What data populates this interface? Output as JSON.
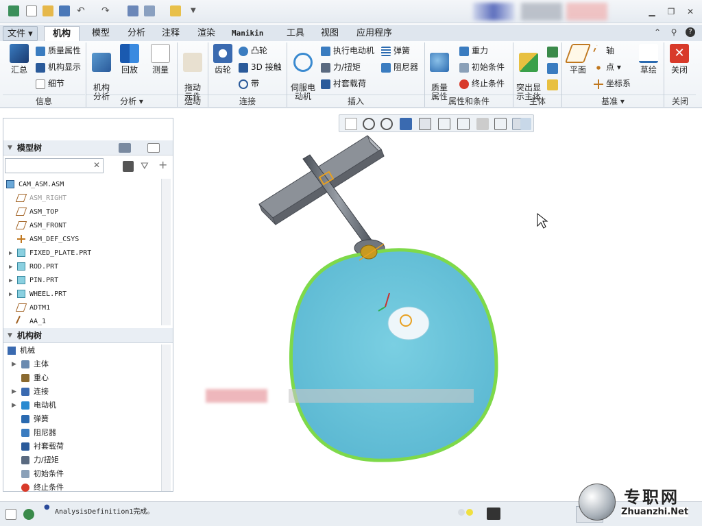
{
  "tabs": [
    {
      "label": "文件",
      "dropdown": true
    },
    {
      "label": "机构",
      "active": true
    },
    {
      "label": "模型"
    },
    {
      "label": "分析"
    },
    {
      "label": "注释"
    },
    {
      "label": "渲染"
    },
    {
      "label": "Manikin"
    },
    {
      "label": "工具"
    },
    {
      "label": "视图"
    },
    {
      "label": "应用程序"
    }
  ],
  "ribbon": {
    "info": {
      "group": "信息",
      "summary": "汇总",
      "mass_props": "质量属性",
      "mech_display": "机构显示",
      "detail": "细节"
    },
    "analysis": {
      "group": "分析",
      "mech_analysis": "机构\n分析",
      "playback": "回放",
      "measure": "测量"
    },
    "motion": {
      "group": "运动",
      "drag": "拖动\n元件"
    },
    "connection": {
      "group": "连接",
      "gear": "齿轮",
      "cam": "凸轮",
      "contact3d": "3D 接触",
      "belt": "带"
    },
    "insert": {
      "group": "插入",
      "servo": "伺服电\n动机",
      "exec_motor": "执行电动机",
      "force": "力/扭矩",
      "bushing": "衬套载荷",
      "spring": "弹簧",
      "damper": "阻尼器"
    },
    "props": {
      "group": "属性和条件",
      "mass": "质量\n属性",
      "gravity": "重力",
      "init_cond": "初始条件",
      "term_cond": "终止条件"
    },
    "body": {
      "group": "主体",
      "highlight": "突出显\n示主体"
    },
    "datum": {
      "group": "基准",
      "plane": "平面",
      "axis": "轴",
      "point": "点",
      "csys": "坐标系",
      "sketch": "草绘"
    },
    "close": {
      "group": "关闭",
      "close": "关闭"
    }
  },
  "model_tree": {
    "title": "模型树",
    "items": [
      {
        "label": "CAM_ASM.ASM",
        "icon": "assembly-icon"
      },
      {
        "label": "ASM_RIGHT",
        "icon": "datum-plane-icon",
        "dim": true
      },
      {
        "label": "ASM_TOP",
        "icon": "datum-plane-icon"
      },
      {
        "label": "ASM_FRONT",
        "icon": "datum-plane-icon"
      },
      {
        "label": "ASM_DEF_CSYS",
        "icon": "csys-icon"
      },
      {
        "label": "FIXED_PLATE.PRT",
        "icon": "part-icon",
        "expand": true
      },
      {
        "label": "ROD.PRT",
        "icon": "part-icon",
        "expand": true
      },
      {
        "label": "PIN.PRT",
        "icon": "part-icon",
        "expand": true
      },
      {
        "label": "WHEEL.PRT",
        "icon": "part-icon",
        "expand": true
      },
      {
        "label": "ADTM1",
        "icon": "datum-plane-icon"
      },
      {
        "label": "AA_1",
        "icon": "axis-icon"
      }
    ]
  },
  "mech_tree": {
    "title": "机构树",
    "root": "机械",
    "items": [
      {
        "label": "主体",
        "expand": true
      },
      {
        "label": "重心"
      },
      {
        "label": "连接",
        "expand": true
      },
      {
        "label": "电动机",
        "expand": true
      },
      {
        "label": "弹簧"
      },
      {
        "label": "阻尼器"
      },
      {
        "label": "衬套载荷"
      },
      {
        "label": "力/扭矩"
      },
      {
        "label": "初始条件"
      },
      {
        "label": "终止条件"
      }
    ]
  },
  "status": {
    "message": "AnalysisDefinition1完成。"
  },
  "watermark": {
    "cn": "专职网",
    "url": "Zhuanzhi.Net"
  },
  "colors": {
    "wheel": "#74c8dc",
    "wheel_edge": "#8fe04a",
    "rod": "#7a8088",
    "accent": "#e8a020"
  }
}
